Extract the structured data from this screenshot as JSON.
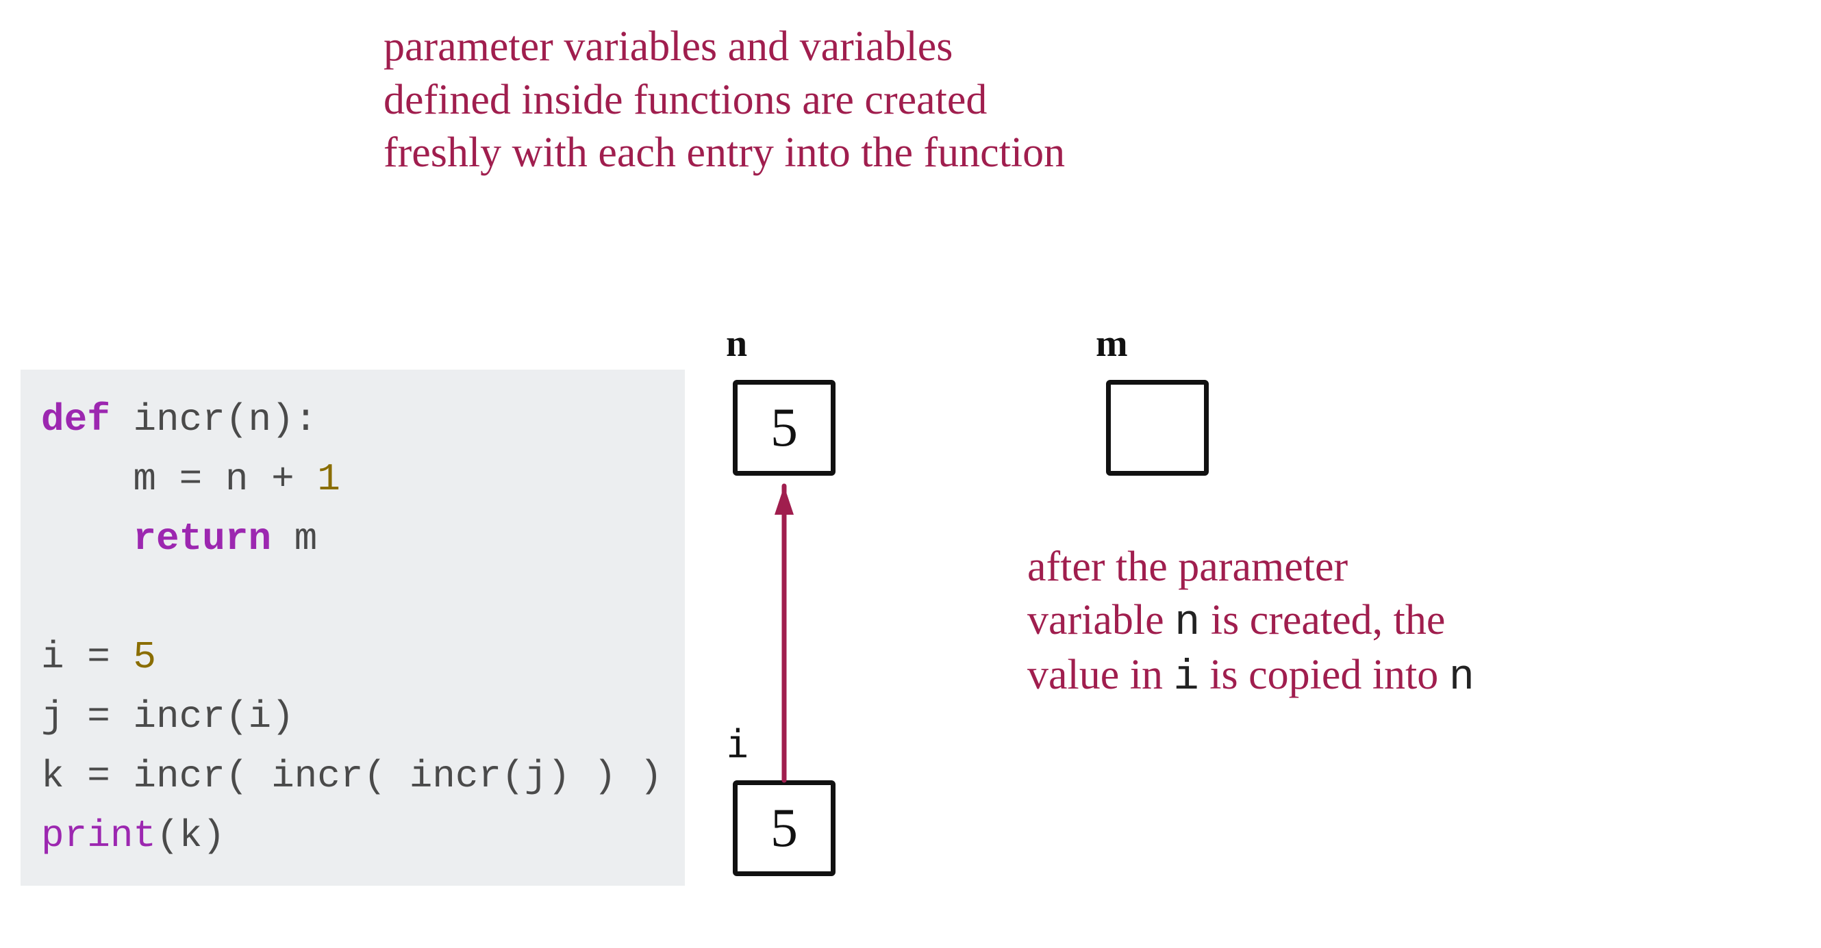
{
  "annotations": {
    "top_line1": "parameter variables and variables",
    "top_line2": "defined inside functions are created",
    "top_line3": "freshly with each entry into the function",
    "side_seg1": "after the parameter",
    "side_seg2_a": "variable ",
    "side_seg2_var": "n",
    "side_seg2_b": " is created, the",
    "side_seg3_a": "value in ",
    "side_seg3_var1": "i",
    "side_seg3_b": " is copied into ",
    "side_seg3_var2": "n"
  },
  "code": {
    "kw_def": "def",
    "fn_name": "incr",
    "sig_rest": "(n):",
    "body1_lhs": "    m ",
    "body1_eq": "=",
    "body1_rhs_a": " n ",
    "body1_plus": "+",
    "body1_num": " 1",
    "kw_return": "    return",
    "return_rest": " m",
    "line_i_a": "i ",
    "line_i_eq": "=",
    "line_i_num": " 5",
    "line_j_a": "j ",
    "line_j_eq": "=",
    "line_j_b": " incr(i)",
    "line_k_a": "k ",
    "line_k_eq": "=",
    "line_k_b": " incr( incr( incr(j) ) )",
    "line_print_fn": "print",
    "line_print_rest": "(k)"
  },
  "memory": {
    "n_label": "n",
    "n_value": "5",
    "m_label": "m",
    "m_value": "",
    "i_label": "i",
    "i_value": "5"
  },
  "colors": {
    "annotation": "#a01e4e",
    "code_bg": "#eceef0",
    "keyword": "#9c27b0",
    "number": "#8a6d00",
    "box_border": "#111111"
  }
}
